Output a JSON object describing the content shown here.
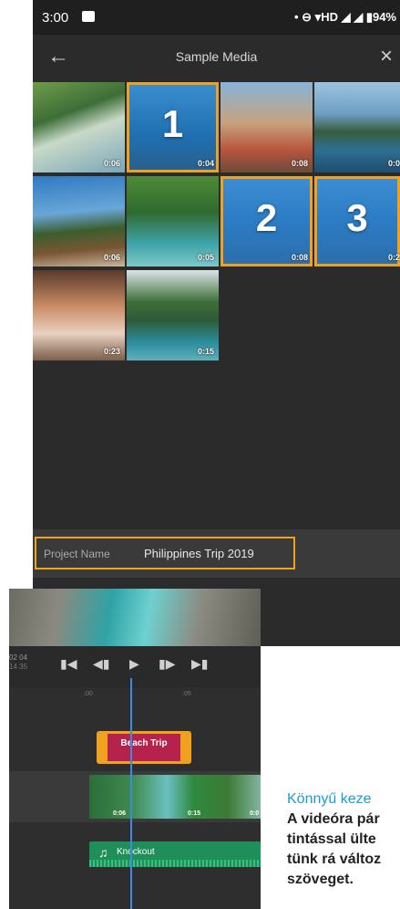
{
  "status_bar": {
    "time": "3:00",
    "right_text": "• ⊖ ▾HD ◢ ◢ ▮94%"
  },
  "media_picker": {
    "title": "Sample Media",
    "back_icon": "arrow-left-icon",
    "close_icon": "close-icon",
    "tiles": [
      {
        "duration": "0:06",
        "number": ""
      },
      {
        "duration": "0:04",
        "number": "1"
      },
      {
        "duration": "0:08",
        "number": ""
      },
      {
        "duration": "0:0",
        "number": ""
      },
      {
        "duration": "0:06",
        "number": ""
      },
      {
        "duration": "0:05",
        "number": ""
      },
      {
        "duration": "0:08",
        "number": "2"
      },
      {
        "duration": "0:2",
        "number": "3"
      },
      {
        "duration": "0:23",
        "number": ""
      },
      {
        "duration": "0:15",
        "number": ""
      }
    ],
    "project_name_label": "Project Name",
    "project_name_value": "Philippines Trip 2019"
  },
  "editor": {
    "timecode_main": "02 04",
    "timecode_sub": "14 35",
    "ruler_ticks": [
      ":00",
      ":05"
    ],
    "title_clip_label": "Beach Trip",
    "video_clip_durations": [
      "0:06",
      "0:15",
      "0:0"
    ],
    "audio_clip_label": "Knockout",
    "audio_icon": "music-note-icon",
    "playhead_color": "#3b8be5"
  },
  "article": {
    "heading": "Könnyű keze",
    "lines": [
      "A videóra pár",
      "tintással ülte",
      "tünk rá változ",
      "szöveget."
    ]
  },
  "colors": {
    "selection": "#f0a11e",
    "title_clip": "#b5224b",
    "audio_clip": "#1f8e58",
    "article_heading": "#1d9ad6"
  }
}
